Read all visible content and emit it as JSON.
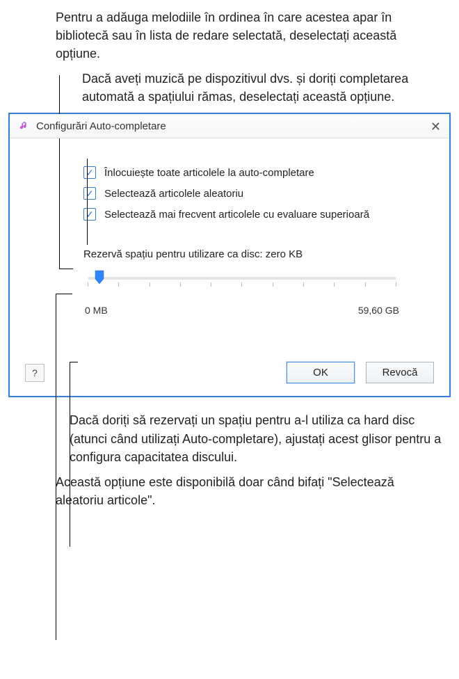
{
  "callouts": {
    "top1": "Pentru a adăuga melodiile în ordinea în care acestea apar în bibliotecă sau în lista de redare selectată, deselectați această opțiune.",
    "top2": "Dacă aveți muzică pe dispozitivul dvs. și doriți completarea automată a spațiului rămas, deselectați această opțiune.",
    "bottom1": "Dacă doriți să rezervați un spațiu pentru a-l utiliza ca hard disc (atunci când utilizați Auto-completare), ajustați acest glisor pentru a configura capacitatea discului.",
    "bottom2": "Această opțiune este disponibilă doar când bifați \"Selectează aleatoriu articole\"."
  },
  "window": {
    "title": "Configurări Auto-completare"
  },
  "options": {
    "replace": "Înlocuiește toate articolele la auto-completare",
    "random": "Selectează articolele aleatoriu",
    "higher": "Selectează mai frecvent articolele cu evaluare superioară"
  },
  "slider": {
    "caption": "Rezervă spațiu pentru utilizare ca disc: zero KB",
    "min_label": "0 MB",
    "max_label": "59,60 GB"
  },
  "buttons": {
    "help": "?",
    "ok": "OK",
    "cancel": "Revocă"
  },
  "icons": {
    "close": "✕",
    "check": "✓"
  }
}
